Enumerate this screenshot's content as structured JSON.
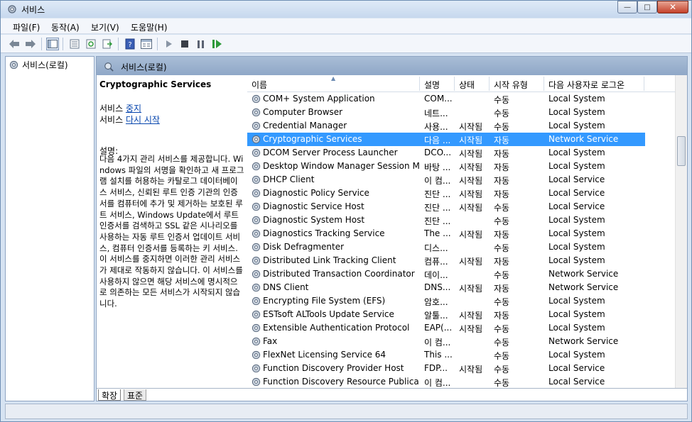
{
  "window": {
    "title": "서비스",
    "buttons": {
      "minimize": "—",
      "maximize": "□",
      "close": "✕"
    }
  },
  "menu": [
    "파일(F)",
    "동작(A)",
    "보기(V)",
    "도움말(H)"
  ],
  "tree": {
    "item": "서비스(로컬)"
  },
  "header": {
    "title": "서비스(로컬)"
  },
  "desc": {
    "service_name": "Cryptographic Services",
    "line1_prefix": "서비스 ",
    "stop_link": "중지",
    "line2_prefix": "서비스 ",
    "restart_link": "다시 시작",
    "label": "설명:",
    "text": "다음 4가지 관리 서비스를 제공합니다. Windows 파일의 서명을 확인하고 새 프로그램 설치를 허용하는 카탈로그 데이터베이스 서비스, 신뢰된 루트 인증 기관의 인증서를 컴퓨터에 추가 및 제거하는 보호된 루트 서비스, Windows Update에서 루트 인증서를 검색하고 SSL 같은 시나리오를 사용하는 자동 루트 인증서 업데이트 서비스, 컴퓨터 인증서를 등록하는 키 서비스. 이 서비스를 중지하면 이러한 관리 서비스가 제대로 작동하지 않습니다. 이 서비스를 사용하지 않으면 해당 서비스에 명시적으로 의존하는 모든 서비스가 시작되지 않습니다."
  },
  "columns": [
    "이름",
    "설명",
    "상태",
    "시작 유형",
    "다음 사용자로 로그온"
  ],
  "services": [
    {
      "name": "COM+ System Application",
      "desc": "COM...",
      "status": "",
      "startup": "수동",
      "logon": "Local System"
    },
    {
      "name": "Computer Browser",
      "desc": "네트...",
      "status": "",
      "startup": "수동",
      "logon": "Local System"
    },
    {
      "name": "Credential Manager",
      "desc": "사용...",
      "status": "시작됨",
      "startup": "수동",
      "logon": "Local System"
    },
    {
      "name": "Cryptographic Services",
      "desc": "다음 ...",
      "status": "시작됨",
      "startup": "자동",
      "logon": "Network Service",
      "selected": true
    },
    {
      "name": "DCOM Server Process Launcher",
      "desc": "DCO...",
      "status": "시작됨",
      "startup": "자동",
      "logon": "Local System"
    },
    {
      "name": "Desktop Window Manager Session Ma...",
      "desc": "바탕 ...",
      "status": "시작됨",
      "startup": "자동",
      "logon": "Local System"
    },
    {
      "name": "DHCP Client",
      "desc": "이 컴...",
      "status": "시작됨",
      "startup": "자동",
      "logon": "Local Service"
    },
    {
      "name": "Diagnostic Policy Service",
      "desc": "진단 ...",
      "status": "시작됨",
      "startup": "자동",
      "logon": "Local Service"
    },
    {
      "name": "Diagnostic Service Host",
      "desc": "진단 ...",
      "status": "시작됨",
      "startup": "수동",
      "logon": "Local Service"
    },
    {
      "name": "Diagnostic System Host",
      "desc": "진단 ...",
      "status": "",
      "startup": "수동",
      "logon": "Local System"
    },
    {
      "name": "Diagnostics Tracking Service",
      "desc": "The ...",
      "status": "시작됨",
      "startup": "자동",
      "logon": "Local System"
    },
    {
      "name": "Disk Defragmenter",
      "desc": "디스...",
      "status": "",
      "startup": "수동",
      "logon": "Local System"
    },
    {
      "name": "Distributed Link Tracking Client",
      "desc": "컴퓨...",
      "status": "시작됨",
      "startup": "자동",
      "logon": "Local System"
    },
    {
      "name": "Distributed Transaction Coordinator",
      "desc": "데이...",
      "status": "",
      "startup": "수동",
      "logon": "Network Service"
    },
    {
      "name": "DNS Client",
      "desc": "DNS...",
      "status": "시작됨",
      "startup": "자동",
      "logon": "Network Service"
    },
    {
      "name": "Encrypting File System (EFS)",
      "desc": "암호...",
      "status": "",
      "startup": "수동",
      "logon": "Local System"
    },
    {
      "name": "ESTsoft ALTools Update Service",
      "desc": "알툴...",
      "status": "시작됨",
      "startup": "자동",
      "logon": "Local System"
    },
    {
      "name": "Extensible Authentication Protocol",
      "desc": "EAP(...",
      "status": "시작됨",
      "startup": "수동",
      "logon": "Local System"
    },
    {
      "name": "Fax",
      "desc": "이 컴...",
      "status": "",
      "startup": "수동",
      "logon": "Network Service"
    },
    {
      "name": "FlexNet Licensing Service 64",
      "desc": "This ...",
      "status": "",
      "startup": "수동",
      "logon": "Local System"
    },
    {
      "name": "Function Discovery Provider Host",
      "desc": "FDP...",
      "status": "시작됨",
      "startup": "수동",
      "logon": "Local Service"
    },
    {
      "name": "Function Discovery Resource Publication",
      "desc": "이 컴...",
      "status": "",
      "startup": "수동",
      "logon": "Local Service"
    }
  ],
  "tabs": [
    "확장",
    "표준"
  ]
}
